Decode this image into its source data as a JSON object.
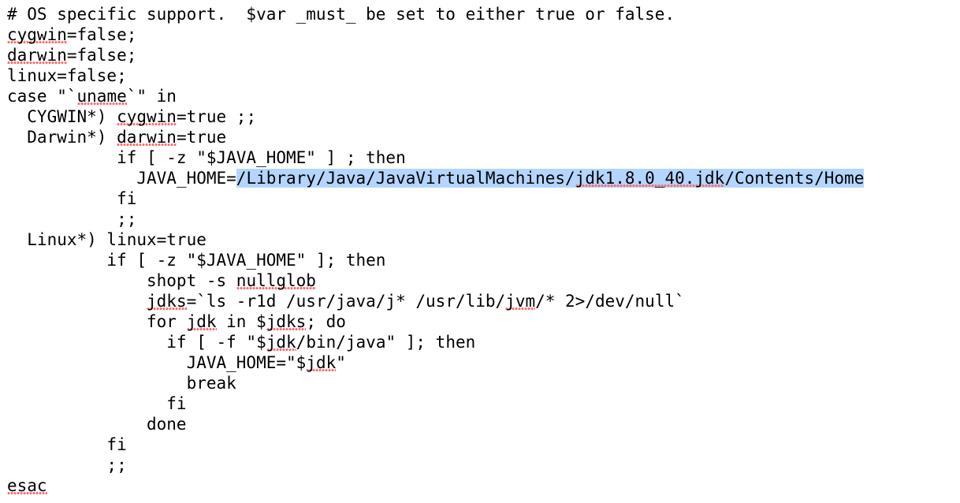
{
  "editor": {
    "highlight_color": "#b4d5fe",
    "spell_color": "#ff6b6b",
    "lines": [
      [
        {
          "t": "# OS specific support.  $var _must_ be set to either true or false."
        }
      ],
      [
        {
          "t": "cygwin",
          "s": 1
        },
        {
          "t": "=false;"
        }
      ],
      [
        {
          "t": "darwin",
          "s": 1
        },
        {
          "t": "=false;"
        }
      ],
      [
        {
          "t": "linux=false;"
        }
      ],
      [
        {
          "t": "case \"`"
        },
        {
          "t": "uname",
          "s": 1
        },
        {
          "t": "`\" in"
        }
      ],
      [
        {
          "t": "  CYGWIN*) "
        },
        {
          "t": "cygwin",
          "s": 1
        },
        {
          "t": "=true ;;"
        }
      ],
      [
        {
          "t": "  Darwin*) "
        },
        {
          "t": "darwin",
          "s": 1
        },
        {
          "t": "=true"
        }
      ],
      [
        {
          "t": "           if [ -z \"$JAVA_HOME\" ] ; then"
        }
      ],
      [
        {
          "t": "             JAVA_HOME="
        },
        {
          "t": "/Library/Java/JavaVirtualMachines/",
          "h": 1
        },
        {
          "t": "jdk1.8.0_40.jdk",
          "h": 1,
          "s": 1
        },
        {
          "t": "/Contents/Home",
          "h": 1
        }
      ],
      [
        {
          "t": "           fi"
        }
      ],
      [
        {
          "t": "           ;;"
        }
      ],
      [
        {
          "t": "  Linux*) linux=true"
        }
      ],
      [
        {
          "t": "          if [ -z \"$JAVA_HOME\" ]; then"
        }
      ],
      [
        {
          "t": "              shopt -s "
        },
        {
          "t": "nullglob",
          "s": 1
        }
      ],
      [
        {
          "t": "              "
        },
        {
          "t": "jdks",
          "s": 1
        },
        {
          "t": "=`ls -r1d /usr/java/j* /usr/lib/"
        },
        {
          "t": "jvm",
          "s": 1
        },
        {
          "t": "/* 2>/dev/null`"
        }
      ],
      [
        {
          "t": "              for "
        },
        {
          "t": "jdk",
          "s": 1
        },
        {
          "t": " in $"
        },
        {
          "t": "jdks",
          "s": 1
        },
        {
          "t": "; do"
        }
      ],
      [
        {
          "t": "                if [ -f \"$"
        },
        {
          "t": "jdk",
          "s": 1
        },
        {
          "t": "/bin/java\" ]; then"
        }
      ],
      [
        {
          "t": "                  JAVA_HOME=\"$"
        },
        {
          "t": "jdk",
          "s": 1
        },
        {
          "t": "\""
        }
      ],
      [
        {
          "t": "                  break"
        }
      ],
      [
        {
          "t": "                fi"
        }
      ],
      [
        {
          "t": "              done"
        }
      ],
      [
        {
          "t": "          fi"
        }
      ],
      [
        {
          "t": "          ;;"
        }
      ],
      [
        {
          "t": "esac",
          "s": 1
        }
      ]
    ]
  }
}
